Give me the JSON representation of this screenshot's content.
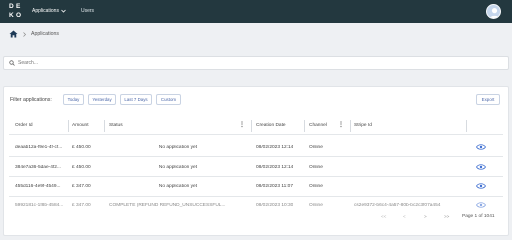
{
  "header": {
    "logo": [
      "D",
      "E",
      "K",
      "O"
    ],
    "nav_applications": "Applications",
    "nav_users": "Users"
  },
  "breadcrumb": {
    "current": "Applications"
  },
  "search": {
    "placeholder": "Search..."
  },
  "filters": {
    "label": "Filter applications:",
    "buttons": [
      "Today",
      "Yesterday",
      "Last 7 Days",
      "Custom"
    ],
    "export": "Export"
  },
  "table": {
    "columns": [
      "Order Id",
      "Amount",
      "Status",
      "Creation Date",
      "Channel",
      "Stripe Id"
    ],
    "rows": [
      {
        "order_id": "deaab12a-f9e1-4f-cf...",
        "amount": "£ 450.00",
        "status": "No application yet",
        "date": "08/02/2023 12:14",
        "channel": "Online",
        "stripe_id": ""
      },
      {
        "order_id": "384e7a36-5dae-4f2...",
        "amount": "£ 450.00",
        "status": "No application yet",
        "date": "08/02/2023 12:14",
        "channel": "Online",
        "stripe_id": ""
      },
      {
        "order_id": "455d116-4e9f-4549...",
        "amount": "£ 347.00",
        "status": "No application yet",
        "date": "08/02/2023 11:07",
        "channel": "Online",
        "stripe_id": ""
      },
      {
        "order_id": "5992181c-1f8b-4584...",
        "amount": "£ 347.00",
        "status": "COMPLETE (REFUND REFUND_UNSUCCESSFUL...",
        "date": "08/02/2023 10:30",
        "channel": "Online",
        "stripe_id": "cs2e9372-b6c4-4a57-80b-bc2c3f07a454"
      }
    ]
  },
  "pagination": {
    "first": "<<",
    "prev": "<",
    "next": ">",
    "last": ">>",
    "page_info": "Page 1 of 1041"
  },
  "colors": {
    "topbar": "#23383f",
    "accent": "#4a66a8",
    "eye": "#3f6fd1"
  }
}
